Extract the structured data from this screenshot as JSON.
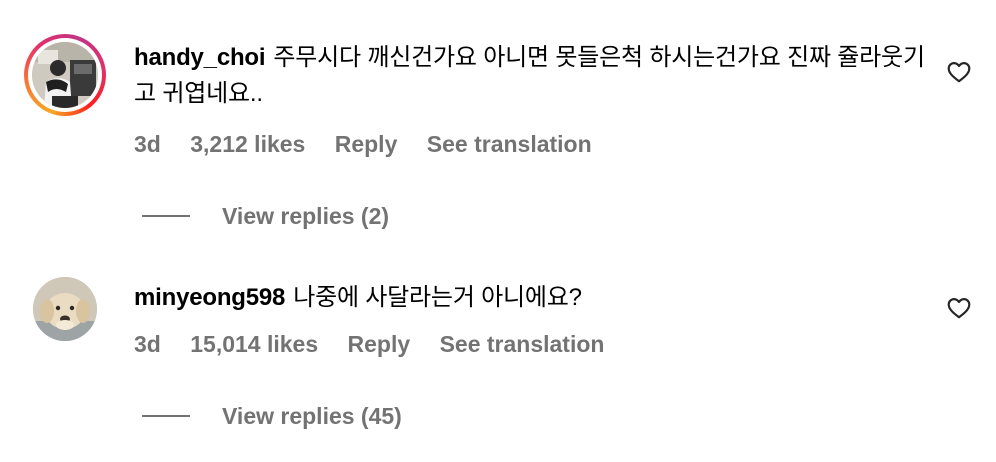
{
  "comments": [
    {
      "username": "handy_choi",
      "text": "주무시다 깨신건가요 아니면 못들은척 하시는건가요 진짜 쥴라웃기고 귀엽네요..",
      "time": "3d",
      "likes": "3,212 likes",
      "reply_label": "Reply",
      "translate_label": "See translation",
      "view_replies_label": "View replies (2)",
      "avatar_icon": "person-photo-avatar",
      "has_story_ring": true
    },
    {
      "username": "minyeong598",
      "text": "나중에 사달라는거 아니에요?",
      "time": "3d",
      "likes": "15,014 likes",
      "reply_label": "Reply",
      "translate_label": "See translation",
      "view_replies_label": "View replies (45)",
      "avatar_icon": "dog-photo-avatar",
      "has_story_ring": false
    }
  ],
  "colors": {
    "text": "#000000",
    "meta": "#737373",
    "story_ring": [
      "#f9a825",
      "#e1306c",
      "#c13584"
    ]
  }
}
